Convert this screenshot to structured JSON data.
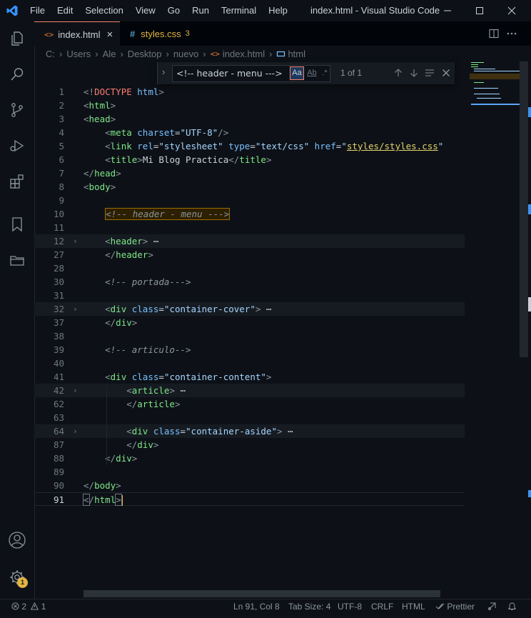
{
  "titlebar": {
    "menu": [
      "File",
      "Edit",
      "Selection",
      "View",
      "Go",
      "Run",
      "Terminal",
      "Help"
    ],
    "title": "index.html - Visual Studio Code"
  },
  "tabs": [
    {
      "label": "index.html",
      "close": "×"
    },
    {
      "label": "styles.css",
      "badge": "3"
    }
  ],
  "breadcrumb": {
    "items": [
      "C:",
      "Users",
      "Ale",
      "Desktop",
      "nuevo",
      "index.html",
      "html"
    ]
  },
  "find": {
    "query": "<!-- header - menu --->",
    "match_case": "Aa",
    "whole_word": "Ab",
    "regex": ".*",
    "result": "1 of 1"
  },
  "code": {
    "lines": [
      {
        "n": "1"
      },
      {
        "n": "2"
      },
      {
        "n": "3"
      },
      {
        "n": "4"
      },
      {
        "n": "5"
      },
      {
        "n": "6"
      },
      {
        "n": "7"
      },
      {
        "n": "8"
      },
      {
        "n": "9"
      },
      {
        "n": "10"
      },
      {
        "n": "11"
      },
      {
        "n": "12"
      },
      {
        "n": "27"
      },
      {
        "n": "28"
      },
      {
        "n": "30"
      },
      {
        "n": "31"
      },
      {
        "n": "32"
      },
      {
        "n": "37"
      },
      {
        "n": "38"
      },
      {
        "n": "39"
      },
      {
        "n": "40"
      },
      {
        "n": "41"
      },
      {
        "n": "42"
      },
      {
        "n": "62"
      },
      {
        "n": "63"
      },
      {
        "n": "64"
      },
      {
        "n": "87"
      },
      {
        "n": "88"
      },
      {
        "n": "89"
      },
      {
        "n": "90"
      },
      {
        "n": "91"
      }
    ],
    "tokens": {
      "doctype_kw": "DOCTYPE",
      "doctype_html": "html",
      "html": "html",
      "head": "head",
      "meta": "meta",
      "charset": "charset",
      "utf8": "\"UTF-8\"",
      "link": "link",
      "rel": "rel",
      "stylesheet": "\"stylesheet\"",
      "type": "type",
      "textcss": "\"text/css\"",
      "href": "href",
      "styles_path": "styles/styles.css",
      "title": "title",
      "title_text": "Mi Blog Practica",
      "body": "body",
      "comment_header": "<!-- header - menu --->",
      "header": "header",
      "comment_portada": "<!-- portada--->",
      "div": "div",
      "class": "class",
      "container_cover": "\"container-cover\"",
      "comment_articulo": "<!-- articulo-->",
      "container_content": "\"container-content\"",
      "article": "article",
      "container_aside": "\"container-aside\"",
      "ellipsis": "⋯"
    }
  },
  "status": {
    "errors": "2",
    "warnings": "1",
    "position": "Ln 91, Col 8",
    "tab_size": "Tab Size: 4",
    "encoding": "UTF-8",
    "eol": "CRLF",
    "language": "HTML",
    "prettier": "Prettier"
  },
  "accounts_badge": "1",
  "colors": {
    "background": "#0d1117",
    "tag": "#7ee787",
    "attribute": "#79c0ff",
    "string": "#a5d6ff",
    "comment": "#8b949e",
    "accent": "#f78166",
    "badge": "#e3b341"
  }
}
